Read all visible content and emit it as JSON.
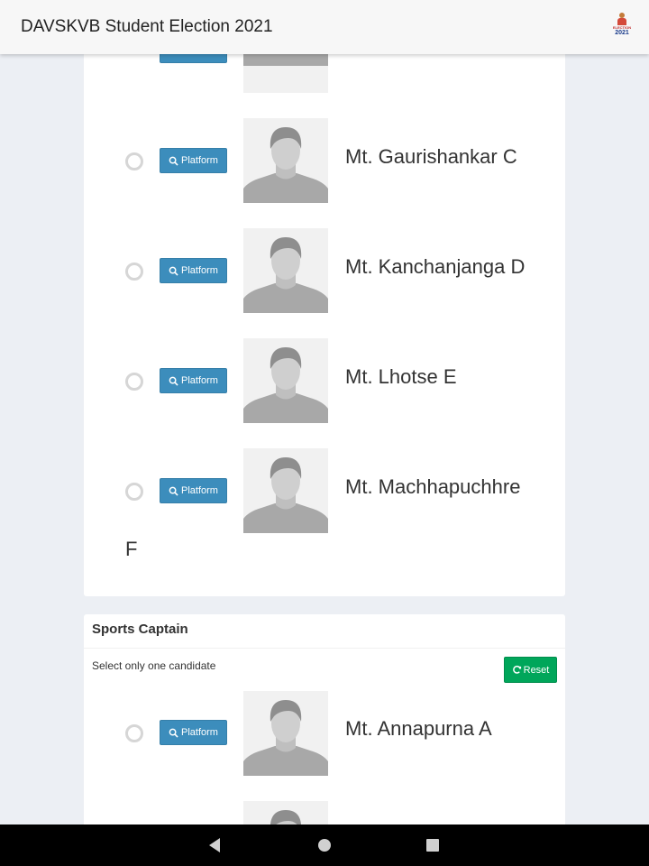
{
  "app": {
    "title": "DAVSKVB Student Election 2021",
    "logo_text": "ELECTION",
    "logo_year": "2021"
  },
  "section_one": {
    "candidates": [
      {
        "name": "Mt. Gaurishankar C"
      },
      {
        "name": "Mt. Kanchanjanga D"
      },
      {
        "name": "Mt. Lhotse E"
      },
      {
        "name": "Mt. Machhapuchhre",
        "name_continued": "F"
      }
    ]
  },
  "sports_captain": {
    "title": "Sports Captain",
    "hint": "Select only one candidate",
    "reset_label": "Reset",
    "candidates": [
      {
        "name": "Mt. Annapurna A"
      }
    ]
  },
  "labels": {
    "platform": "Platform"
  },
  "colors": {
    "platform_button": "#3c8dbc",
    "reset_button": "#00a65a",
    "appbar": "#f7f7f7",
    "background": "#eceff4"
  }
}
